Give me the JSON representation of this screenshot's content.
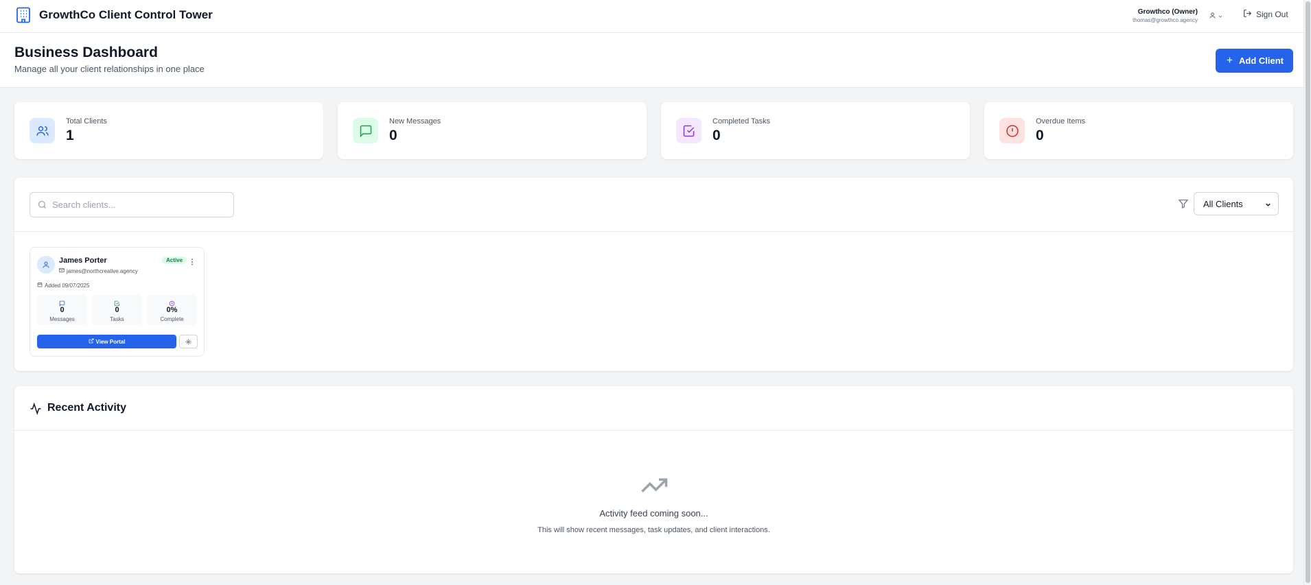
{
  "app": {
    "title": "GrowthCo Client Control Tower"
  },
  "user": {
    "name": "Growthco (Owner)",
    "email": "thomas@growthco.agency",
    "sign_out_label": "Sign Out"
  },
  "header": {
    "title": "Business Dashboard",
    "subtitle": "Manage all your client relationships in one place",
    "add_client_label": "Add Client"
  },
  "stats": [
    {
      "label": "Total Clients",
      "value": "1",
      "icon": "users-icon",
      "bg": "#dbeafe",
      "color": "#2563eb"
    },
    {
      "label": "New Messages",
      "value": "0",
      "icon": "message-icon",
      "bg": "#dcfce7",
      "color": "#16a34a"
    },
    {
      "label": "Completed Tasks",
      "value": "0",
      "icon": "check-square-icon",
      "bg": "#f3e8ff",
      "color": "#9333ea"
    },
    {
      "label": "Overdue Items",
      "value": "0",
      "icon": "alert-circle-icon",
      "bg": "#fee2e2",
      "color": "#dc2626"
    }
  ],
  "clients_panel": {
    "search_placeholder": "Search clients...",
    "filter_selected": "All Clients",
    "clients": [
      {
        "name": "James Porter",
        "email": "james@northcreative.agency",
        "status": "Active",
        "added": "Added 09/07/2025",
        "stats": [
          {
            "value": "0",
            "label": "Messages"
          },
          {
            "value": "0",
            "label": "Tasks"
          },
          {
            "value": "0%",
            "label": "Complete"
          }
        ],
        "view_portal_label": "View Portal"
      }
    ]
  },
  "activity": {
    "title": "Recent Activity",
    "empty_title": "Activity feed coming soon...",
    "empty_description": "This will show recent messages, task updates, and client interactions."
  },
  "colors": {
    "primary": "#2563eb",
    "active_badge_bg": "#dcfce7",
    "active_badge_text": "#15803d"
  }
}
